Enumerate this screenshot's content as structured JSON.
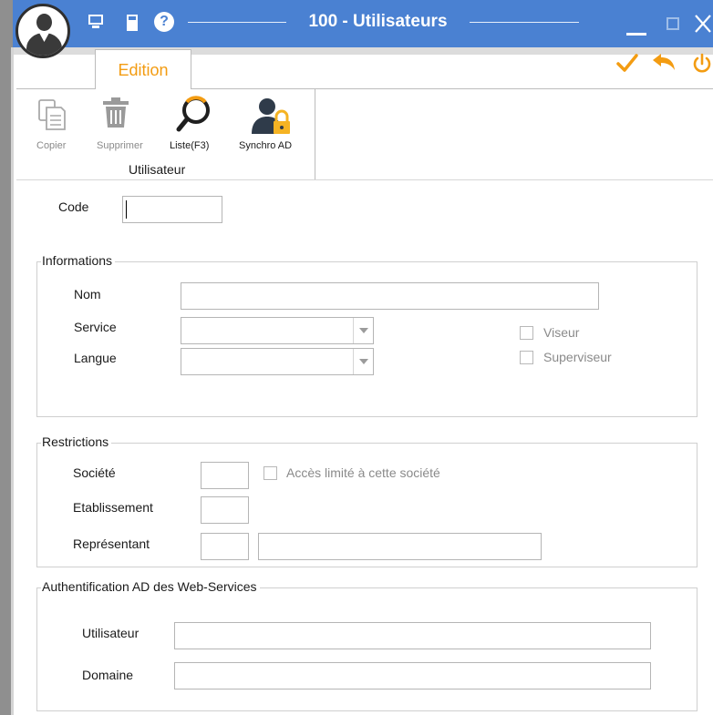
{
  "window": {
    "title": "100 - Utilisateurs"
  },
  "titlebar_icons": [
    "user-avatar-icon",
    "monitor-icon",
    "calculator-icon",
    "help-icon"
  ],
  "window_controls": [
    "minimize-icon",
    "maximize-icon",
    "close-icon"
  ],
  "ribbon": {
    "active_tab": "Edition",
    "actions": [
      "check-icon",
      "undo-icon",
      "power-icon"
    ],
    "group_label": "Utilisateur",
    "buttons": {
      "copy": "Copier",
      "delete": "Supprimer",
      "list": "Liste(F3)",
      "sync": "Synchro AD"
    }
  },
  "form": {
    "code_label": "Code",
    "code_value": "",
    "informations": {
      "legend": "Informations",
      "nom_label": "Nom",
      "nom_value": "",
      "service_label": "Service",
      "service_value": "",
      "langue_label": "Langue",
      "langue_value": "",
      "viseur_label": "Viseur",
      "viseur_checked": false,
      "superviseur_label": "Superviseur",
      "superviseur_checked": false
    },
    "restrictions": {
      "legend": "Restrictions",
      "societe_label": "Société",
      "societe_value": "",
      "acces_label": "Accès limité à cette société",
      "acces_checked": false,
      "etablissement_label": "Etablissement",
      "etablissement_value": "",
      "representant_label": "Représentant",
      "representant_code": "",
      "representant_name": ""
    },
    "auth": {
      "legend": "Authentification AD des Web-Services",
      "utilisateur_label": "Utilisateur",
      "utilisateur_value": "",
      "domaine_label": "Domaine",
      "domaine_value": ""
    }
  },
  "colors": {
    "titlebar": "#4a81d2",
    "accent": "#f39c12",
    "disabled_text": "#8a8a8a"
  }
}
